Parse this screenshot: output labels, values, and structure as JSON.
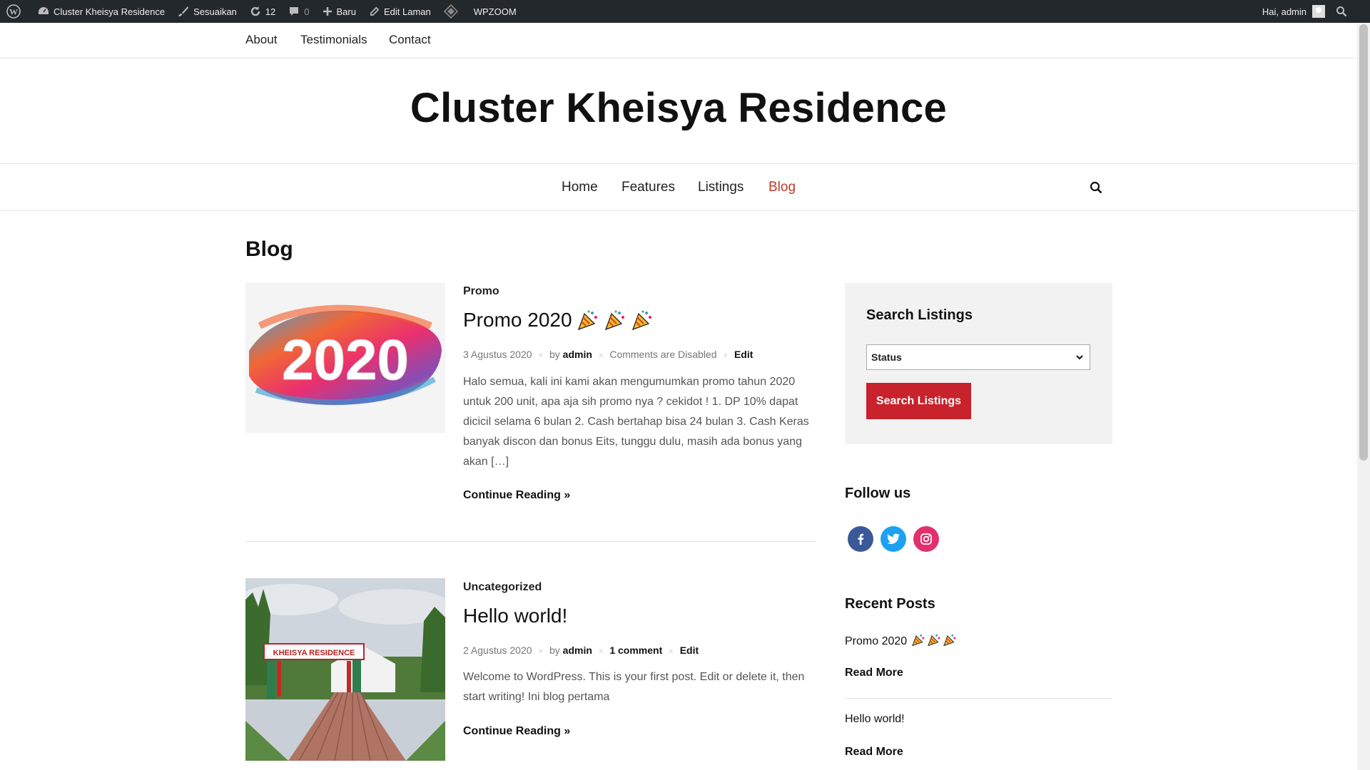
{
  "admin_bar": {
    "site_name": "Cluster Kheisya Residence",
    "customize": "Sesuaikan",
    "updates_count": "12",
    "comments_count": "0",
    "new": "Baru",
    "edit_page": "Edit Laman",
    "wpzoom": "WPZOOM",
    "greeting": "Hai, admin"
  },
  "top_nav": [
    "About",
    "Testimonials",
    "Contact"
  ],
  "site_title": "Cluster Kheisya Residence",
  "main_nav": [
    "Home",
    "Features",
    "Listings",
    "Blog"
  ],
  "accent_color": "#c0392b",
  "page_title": "Blog",
  "posts": [
    {
      "category": "Promo",
      "title": "Promo 2020",
      "title_icons": [
        "party-popper-icon",
        "party-popper-icon",
        "party-popper-icon"
      ],
      "date": "3 Agustus 2020",
      "by": "by",
      "author": "admin",
      "comments": "Comments are Disabled",
      "edit": "Edit",
      "excerpt": "Halo semua, kali ini kami akan mengumumkan promo tahun 2020 untuk 200 unit, apa aja sih promo nya ? cekidot ! 1. DP 10% dapat dicicil selama 6 bulan 2. Cash bertahap bisa 24 bulan 3. Cash Keras banyak discon dan bonus Eits, tunggu dulu, masih ada bonus yang akan […]",
      "more": "Continue Reading »",
      "thumb_text": "2020"
    },
    {
      "category": "Uncategorized",
      "title": "Hello world!",
      "date": "2 Agustus 2020",
      "by": "by",
      "author": "admin",
      "comments": "1 comment",
      "edit": "Edit",
      "excerpt": "Welcome to WordPress. This is your first post. Edit or delete it, then start writing! Ini blog pertama",
      "more": "Continue Reading »",
      "thumb_text": "KHEISYA RESIDENCE"
    }
  ],
  "sidebar": {
    "search_title": "Search Listings",
    "status_select": "Status",
    "search_button": "Search Listings",
    "follow_title": "Follow us",
    "social_icons": [
      "facebook-icon",
      "twitter-icon",
      "instagram-icon"
    ],
    "recent_title": "Recent Posts",
    "recent": [
      {
        "title": "Promo 2020",
        "more": "Read More"
      },
      {
        "title": "Hello world!",
        "more": "Read More"
      }
    ]
  }
}
